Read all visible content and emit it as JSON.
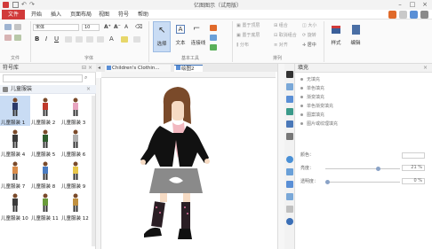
{
  "window": {
    "title": "亿图图示（试用版）",
    "controls": [
      "minimize-icon",
      "maximize-icon",
      "close-icon"
    ]
  },
  "menu": {
    "file": "文件",
    "items": [
      "开始",
      "插入",
      "页面布局",
      "视图",
      "符号",
      "帮助"
    ]
  },
  "ribbon": {
    "groups": [
      "文件",
      "字体",
      "基本工具",
      "排列"
    ],
    "font_name": "宋体",
    "font_size": "10",
    "select_label": "选择",
    "text_label": "文本",
    "connector_label": "连接线",
    "arrange_items": [
      "置于顶层",
      "置于底层",
      "组合",
      "取消组合",
      "大小",
      "旋转",
      "居中",
      "对齐",
      "分布"
    ],
    "style_label": "样式",
    "edit_label": "编辑"
  },
  "library": {
    "header": "符号库",
    "category": "儿童服装",
    "shapes": [
      {
        "label": "儿童服装 1",
        "color": "#2b3a6b"
      },
      {
        "label": "儿童服装 2",
        "color": "#c0392b"
      },
      {
        "label": "儿童服装 3",
        "color": "#e8a5c0"
      },
      {
        "label": "儿童服装 4",
        "color": "#3a3a3a"
      },
      {
        "label": "儿童服装 5",
        "color": "#2e5d2e"
      },
      {
        "label": "儿童服装 6",
        "color": "#b0b0b0"
      },
      {
        "label": "儿童服装 7",
        "color": "#d98c4a"
      },
      {
        "label": "儿童服装 8",
        "color": "#4a7bc0"
      },
      {
        "label": "儿童服装 9",
        "color": "#e8c64a"
      },
      {
        "label": "儿童服装 10",
        "color": "#3b3b3b"
      },
      {
        "label": "儿童服装 11",
        "color": "#6a9a3a"
      },
      {
        "label": "儿童服装 12",
        "color": "#c09040"
      }
    ]
  },
  "tabs": [
    {
      "label": "Children's Clothin..."
    },
    {
      "label": "绘图2"
    }
  ],
  "fill_panel": {
    "header": "填充",
    "options": [
      "无填充",
      "单色填充",
      "渐变填充",
      "单色渐变填充",
      "图案填充",
      "图片或纹理填充"
    ],
    "color_label": "颜色：",
    "brightness_label": "亮度：",
    "brightness_value": "21 %",
    "transparency_label": "透明度：",
    "transparency_value": "0 %",
    "brightness_fraction": 0.72,
    "transparency_fraction": 0.0
  },
  "colors": {
    "accent": "#d13a3a",
    "selection": "#c9dcf4",
    "tab_active": "#3b6fb6"
  }
}
